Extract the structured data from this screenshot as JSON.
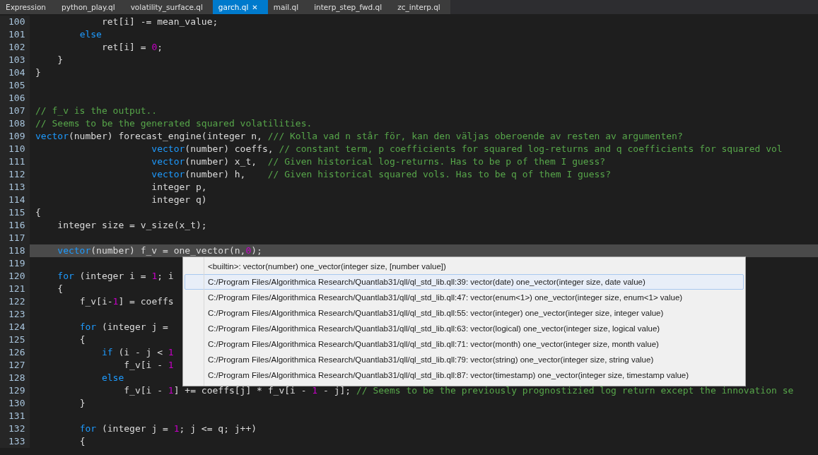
{
  "tabs": [
    {
      "label": "Expression",
      "selected": false
    },
    {
      "label": "python_play.ql",
      "selected": false
    },
    {
      "label": "volatility_surface.ql",
      "selected": false
    },
    {
      "label": "garch.ql",
      "selected": true,
      "close": "✕"
    },
    {
      "label": "mail.ql",
      "selected": false
    },
    {
      "label": "interp_step_fwd.ql",
      "selected": false
    },
    {
      "label": "zc_interp.ql",
      "selected": false
    }
  ],
  "lines": [
    {
      "number": "100",
      "current": false,
      "tokens": [
        {
          "kind": "plain",
          "text": "\t\t\tret[i] -= mean_value;"
        }
      ]
    },
    {
      "number": "101",
      "current": false,
      "tokens": [
        {
          "kind": "keyword",
          "text": "\t\telse"
        }
      ]
    },
    {
      "number": "102",
      "current": false,
      "tokens": [
        {
          "kind": "plain",
          "text": "\t\t\tret[i] = "
        },
        {
          "kind": "number",
          "text": "0"
        },
        {
          "kind": "plain",
          "text": ";"
        }
      ]
    },
    {
      "number": "103",
      "current": false,
      "tokens": [
        {
          "kind": "plain",
          "text": "\t}"
        }
      ]
    },
    {
      "number": "104",
      "current": false,
      "tokens": [
        {
          "kind": "plain",
          "text": "}"
        }
      ]
    },
    {
      "number": "105",
      "current": false
    },
    {
      "number": "106",
      "current": false
    },
    {
      "number": "107",
      "current": false,
      "tokens": [
        {
          "kind": "comment",
          "text": "// f_v is the output.."
        }
      ]
    },
    {
      "number": "108",
      "current": false,
      "tokens": [
        {
          "kind": "comment",
          "text": "// Seems to be the generated squared volatilities."
        }
      ]
    },
    {
      "number": "109",
      "current": false,
      "tokens": [
        {
          "kind": "keyword",
          "text": "vector"
        },
        {
          "kind": "plain",
          "text": "(number) forecast_engine(integer n, "
        },
        {
          "kind": "comment",
          "text": "/// Kolla vad n står för, kan den väljas oberoende av resten av argumenten?"
        }
      ]
    },
    {
      "number": "110",
      "current": false,
      "tokens": [
        {
          "kind": "keyword",
          "text": "\t\t\t\t\t vector"
        },
        {
          "kind": "plain",
          "text": "(number) coeffs, "
        },
        {
          "kind": "comment",
          "text": "// constant term, p coefficients for squared log-returns and q coefficients for squared vol"
        }
      ]
    },
    {
      "number": "111",
      "current": false,
      "tokens": [
        {
          "kind": "keyword",
          "text": "\t\t\t\t\t vector"
        },
        {
          "kind": "plain",
          "text": "(number) x_t,  "
        },
        {
          "kind": "comment",
          "text": "// Given historical log-returns. Has to be p of them I guess?"
        }
      ]
    },
    {
      "number": "112",
      "current": false,
      "tokens": [
        {
          "kind": "keyword",
          "text": "\t\t\t\t\t vector"
        },
        {
          "kind": "plain",
          "text": "(number) h,    "
        },
        {
          "kind": "comment",
          "text": "// Given historical squared vols. Has to be q of them I guess?"
        }
      ]
    },
    {
      "number": "113",
      "current": false,
      "tokens": [
        {
          "kind": "plain",
          "text": "\t\t\t\t\t integer p,"
        }
      ]
    },
    {
      "number": "114",
      "current": false,
      "tokens": [
        {
          "kind": "plain",
          "text": "\t\t\t\t\t integer q)"
        }
      ]
    },
    {
      "number": "115",
      "current": false,
      "tokens": [
        {
          "kind": "plain",
          "text": "{"
        }
      ]
    },
    {
      "number": "116",
      "current": false,
      "tokens": [
        {
          "kind": "plain",
          "text": "\tinteger size = v_size(x_t);"
        }
      ]
    },
    {
      "number": "117",
      "current": false
    },
    {
      "number": "118",
      "current": true,
      "tokens": [
        {
          "kind": "keyword",
          "text": "\tvector"
        },
        {
          "kind": "plain",
          "text": "(number) f_v = one_vector(n,"
        },
        {
          "kind": "number",
          "text": "0"
        },
        {
          "kind": "plain",
          "text": ");"
        }
      ]
    },
    {
      "number": "119",
      "current": false
    },
    {
      "number": "120",
      "current": false,
      "tokens": [
        {
          "kind": "keyword",
          "text": "\tfor"
        },
        {
          "kind": "plain",
          "text": " (integer i = "
        },
        {
          "kind": "number",
          "text": "1"
        },
        {
          "kind": "plain",
          "text": "; i"
        }
      ]
    },
    {
      "number": "121",
      "current": false,
      "tokens": [
        {
          "kind": "plain",
          "text": "\t{"
        }
      ]
    },
    {
      "number": "122",
      "current": false,
      "tokens": [
        {
          "kind": "plain",
          "text": "\t\tf_v[i-"
        },
        {
          "kind": "number",
          "text": "1"
        },
        {
          "kind": "plain",
          "text": "] = coeffs"
        }
      ]
    },
    {
      "number": "123",
      "current": false
    },
    {
      "number": "124",
      "current": false,
      "tokens": [
        {
          "kind": "keyword",
          "text": "\t\tfor"
        },
        {
          "kind": "plain",
          "text": " (integer j ="
        }
      ]
    },
    {
      "number": "125",
      "current": false,
      "tokens": [
        {
          "kind": "plain",
          "text": "\t\t{"
        }
      ]
    },
    {
      "number": "126",
      "current": false,
      "tokens": [
        {
          "kind": "keyword",
          "text": "\t\t\tif"
        },
        {
          "kind": "plain",
          "text": " (i - j < "
        },
        {
          "kind": "number",
          "text": "1"
        }
      ]
    },
    {
      "number": "127",
      "current": false,
      "tokens": [
        {
          "kind": "plain",
          "text": "\t\t\t\tf_v[i - "
        },
        {
          "kind": "number",
          "text": "1"
        }
      ]
    },
    {
      "number": "128",
      "current": false,
      "tokens": [
        {
          "kind": "keyword",
          "text": "\t\t\telse"
        }
      ]
    },
    {
      "number": "129",
      "current": false,
      "tokens": [
        {
          "kind": "plain",
          "text": "\t\t\t\tf_v[i - "
        },
        {
          "kind": "number",
          "text": "1"
        },
        {
          "kind": "plain",
          "text": "] += coeffs[j] * f_v[i - "
        },
        {
          "kind": "number",
          "text": "1"
        },
        {
          "kind": "plain",
          "text": " - j]; "
        },
        {
          "kind": "comment",
          "text": "// Seems to be the previously prognostizied log return except the innovation se"
        }
      ]
    },
    {
      "number": "130",
      "current": false,
      "tokens": [
        {
          "kind": "plain",
          "text": "\t\t}"
        }
      ]
    },
    {
      "number": "131",
      "current": false
    },
    {
      "number": "132",
      "current": false,
      "tokens": [
        {
          "kind": "keyword",
          "text": "\t\tfor"
        },
        {
          "kind": "plain",
          "text": " (integer j = "
        },
        {
          "kind": "number",
          "text": "1"
        },
        {
          "kind": "plain",
          "text": "; j <= q; j++)"
        }
      ]
    },
    {
      "number": "133",
      "current": false,
      "tokens": [
        {
          "kind": "plain",
          "text": "\t\t{"
        }
      ]
    }
  ],
  "completions": [
    {
      "text": "<builtin>: vector(number) one_vector(integer size, [number value])",
      "selected": false
    },
    {
      "text": "C:/Program Files/Algorithmica Research/Quantlab31/qll/ql_std_lib.qll:39: vector(date) one_vector(integer size, date value)",
      "selected": true
    },
    {
      "text": "C:/Program Files/Algorithmica Research/Quantlab31/qll/ql_std_lib.qll:47: vector(enum<1>) one_vector(integer size, enum<1> value)",
      "selected": false
    },
    {
      "text": "C:/Program Files/Algorithmica Research/Quantlab31/qll/ql_std_lib.qll:55: vector(integer) one_vector(integer size, integer value)",
      "selected": false
    },
    {
      "text": "C:/Program Files/Algorithmica Research/Quantlab31/qll/ql_std_lib.qll:63: vector(logical) one_vector(integer size, logical value)",
      "selected": false
    },
    {
      "text": "C:/Program Files/Algorithmica Research/Quantlab31/qll/ql_std_lib.qll:71: vector(month) one_vector(integer size, month value)",
      "selected": false
    },
    {
      "text": "C:/Program Files/Algorithmica Research/Quantlab31/qll/ql_std_lib.qll:79: vector(string) one_vector(integer size, string value)",
      "selected": false
    },
    {
      "text": "C:/Program Files/Algorithmica Research/Quantlab31/qll/ql_std_lib.qll:87: vector(timestamp) one_vector(integer size, timestamp value)",
      "selected": false
    }
  ]
}
